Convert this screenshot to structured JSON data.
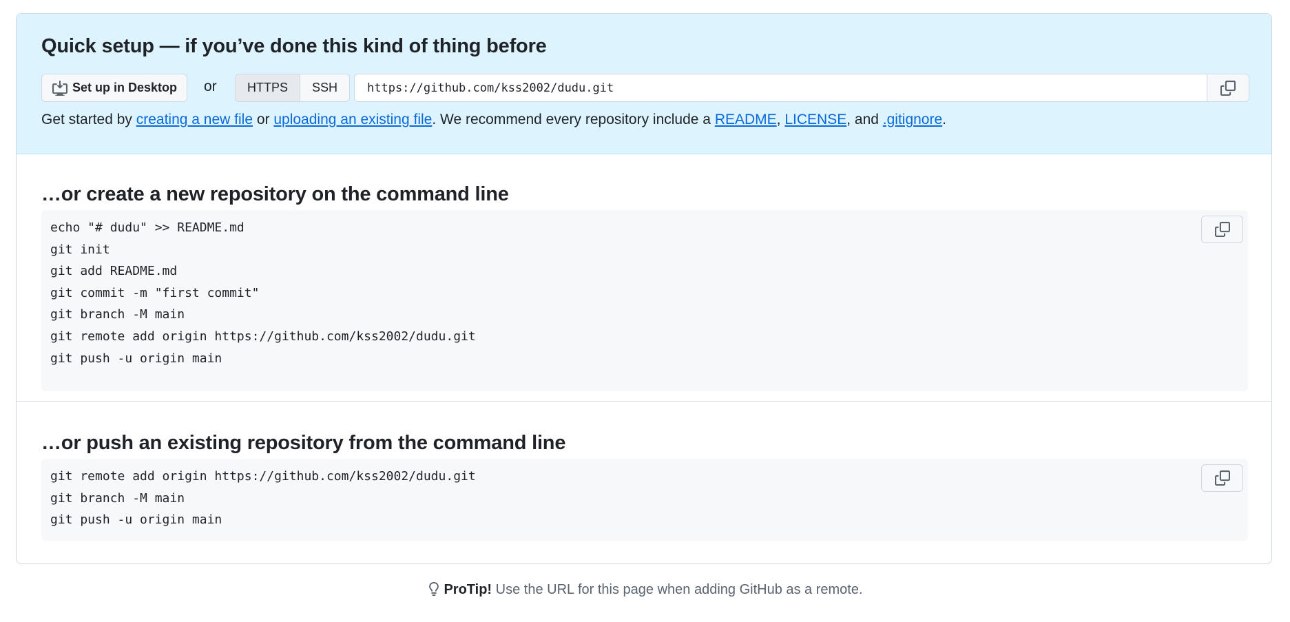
{
  "quick_setup": {
    "title": "Quick setup — if you’ve done this kind of thing before",
    "desktop_button": "Set up in Desktop",
    "or": "or",
    "protocols": [
      "HTTPS",
      "SSH"
    ],
    "selected_protocol": "HTTPS",
    "clone_url": "https://github.com/kss2002/dudu.git",
    "intro": {
      "start": "Get started by ",
      "link_new_file": "creating a new file",
      "or": " or ",
      "link_upload": "uploading an existing file",
      "recommend": ". We recommend every repository include a ",
      "link_readme": "README",
      "comma": ", ",
      "link_license": "LICENSE",
      "and": ", and ",
      "link_gitignore": ".gitignore",
      "end": "."
    }
  },
  "create_section": {
    "title": "…or create a new repository on the command line",
    "code": "echo \"# dudu\" >> README.md\ngit init\ngit add README.md\ngit commit -m \"first commit\"\ngit branch -M main\ngit remote add origin https://github.com/kss2002/dudu.git\ngit push -u origin main"
  },
  "push_section": {
    "title": "…or push an existing repository from the command line",
    "code": "git remote add origin https://github.com/kss2002/dudu.git\ngit branch -M main\ngit push -u origin main"
  },
  "protip": {
    "label": "ProTip!",
    "text": " Use the URL for this page when adding GitHub as a remote."
  },
  "icons": {
    "desktop": "desktop-download-icon",
    "copy": "copy-icon",
    "protip": "light-bulb-icon"
  },
  "colors": {
    "accent_link": "#0969da",
    "quick_setup_bg": "#ddf4ff",
    "code_bg": "#f6f8fa",
    "border": "#d0d7de"
  }
}
